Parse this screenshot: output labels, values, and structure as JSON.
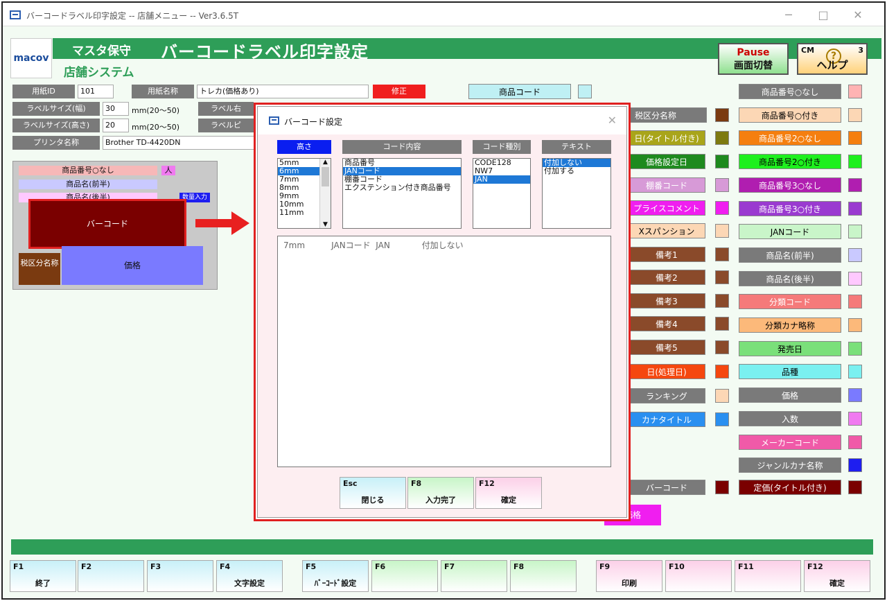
{
  "window": {
    "title": "バーコードラベル印字設定 -- 店舗メニュー -- Ver3.6.5T",
    "min": "─",
    "max": "□",
    "close": "✕"
  },
  "header": {
    "logo": "macov",
    "maint": "マスタ保守",
    "title": "バーコードラベル印字設定",
    "system": "店舗システム"
  },
  "top_buttons": {
    "pause": "Pause",
    "pause_sub": "画面切替",
    "cm": "CM",
    "cm_num": "3",
    "help": "ヘルプ",
    "help_icon": "?"
  },
  "form": {
    "paper_id_label": "用紙ID",
    "paper_id": "101",
    "paper_name_label": "用紙名称",
    "paper_name": "トレカ(価格あり)",
    "fix_label": "修正",
    "width_label": "ラベルサイズ(幅)",
    "width": "30",
    "width_unit": "mm(20～50)",
    "height_label": "ラベルサイズ(高さ)",
    "height": "20",
    "height_unit": "mm(20～50)",
    "margin_label": "ラベル右",
    "pitch_label": "ラベルピ",
    "printer_label": "プリンタ名称",
    "printer": "Brother TD-4420DN"
  },
  "preview": {
    "row1": "商品番号○なし",
    "row1_tag": "人",
    "row2": "商品名(前半)",
    "row3": "商品名(後半)",
    "row3_tag": "数量入力",
    "barcode": "バーコード",
    "tax": "税区分名称",
    "price": "価格"
  },
  "right_col1": [
    {
      "label": "商品コード",
      "bg": "#bff0f4",
      "fg": "#000",
      "swatch": "#bff0f4"
    },
    {
      "label": "税区分名称",
      "bg": "#7a7a7a",
      "fg": "#fff",
      "swatch": "#7a3a10"
    },
    {
      "label": "日(タイトル付き)",
      "bg": "#a9a51a",
      "fg": "#fff",
      "swatch": "#7d7a10"
    },
    {
      "label": "価格設定日",
      "bg": "#1e8a1e",
      "fg": "#fff",
      "swatch": "#1e8a1e"
    },
    {
      "label": "棚番コード",
      "bg": "#d79ad7",
      "fg": "#fff",
      "swatch": "#d79ad7"
    },
    {
      "label": "プライスコメント",
      "bg": "#f01ef0",
      "fg": "#fff",
      "swatch": "#f01ef0"
    },
    {
      "label": "Xスパンション",
      "bg": "#fcd7b5",
      "fg": "#000",
      "swatch": "#fcd7b5"
    },
    {
      "label": "備考1",
      "bg": "#8a4a2a",
      "fg": "#fff",
      "swatch": "#8a4a2a"
    },
    {
      "label": "備考2",
      "bg": "#8a4a2a",
      "fg": "#fff",
      "swatch": "#8a4a2a"
    },
    {
      "label": "備考3",
      "bg": "#8a4a2a",
      "fg": "#fff",
      "swatch": "#8a4a2a"
    },
    {
      "label": "備考4",
      "bg": "#8a4a2a",
      "fg": "#fff",
      "swatch": "#8a4a2a"
    },
    {
      "label": "備考5",
      "bg": "#8a4a2a",
      "fg": "#fff",
      "swatch": "#8a4a2a"
    },
    {
      "label": "日(処理日)",
      "bg": "#f5470f",
      "fg": "#fff",
      "swatch": "#f5470f"
    },
    {
      "label": "ランキング",
      "bg": "#7a7a7a",
      "fg": "#fff",
      "swatch": "#fcd7b5"
    },
    {
      "label": "カナタイトル",
      "bg": "#2a8ff0",
      "fg": "#fff",
      "swatch": "#2a8ff0"
    }
  ],
  "right_col2": [
    {
      "label": "商品番号○なし",
      "bg": "#7a7a7a",
      "fg": "#fff",
      "swatch": "#ffb3b3"
    },
    {
      "label": "商品番号○付き",
      "bg": "#fcd7b5",
      "fg": "#000",
      "swatch": "#fcd7b5"
    },
    {
      "label": "商品番号2○なし",
      "bg": "#f57f0f",
      "fg": "#fff",
      "swatch": "#f57f0f"
    },
    {
      "label": "商品番号2○付き",
      "bg": "#1ef01e",
      "fg": "#000",
      "swatch": "#1ef01e"
    },
    {
      "label": "商品番号3○なし",
      "bg": "#b01eb0",
      "fg": "#fff",
      "swatch": "#b01eb0"
    },
    {
      "label": "商品番号3○付き",
      "bg": "#9a3ad0",
      "fg": "#fff",
      "swatch": "#9a3ad0"
    },
    {
      "label": "JANコード",
      "bg": "#c9f5c9",
      "fg": "#000",
      "swatch": "#c9f5c9"
    },
    {
      "label": "商品名(前半)",
      "bg": "#7a7a7a",
      "fg": "#fff",
      "swatch": "#c9c9ff"
    },
    {
      "label": "商品名(後半)",
      "bg": "#7a7a7a",
      "fg": "#fff",
      "swatch": "#ffc9ff"
    },
    {
      "label": "分類コード",
      "bg": "#f57a7a",
      "fg": "#fff",
      "swatch": "#f57a7a"
    },
    {
      "label": "分類カナ略称",
      "bg": "#fcb97a",
      "fg": "#000",
      "swatch": "#fcb97a"
    },
    {
      "label": "発売日",
      "bg": "#7ae07a",
      "fg": "#000",
      "swatch": "#7ae07a"
    },
    {
      "label": "品種",
      "bg": "#7af0f0",
      "fg": "#000",
      "swatch": "#7af0f0"
    },
    {
      "label": "価格",
      "bg": "#7a7a7a",
      "fg": "#fff",
      "swatch": "#7a7aff"
    },
    {
      "label": "入数",
      "bg": "#7a7a7a",
      "fg": "#fff",
      "swatch": "#f07af0"
    },
    {
      "label": "メーカーコード",
      "bg": "#f05aa8",
      "fg": "#fff",
      "swatch": "#f05aa8"
    },
    {
      "label": "ジャンルカナ名称",
      "bg": "#7a7a7a",
      "fg": "#fff",
      "swatch": "#1e1ef0"
    }
  ],
  "bottom_right": {
    "barcode_label": "バーコード",
    "barcode_swatch": "#7a0000",
    "teika": "定価(タイトル付き)",
    "teika_swatch": "#7a0000",
    "magenta": "価格"
  },
  "dialog": {
    "title": "バーコード設定",
    "close": "✕",
    "hdr_height": "高さ",
    "hdr_content": "コード内容",
    "hdr_type": "コード種別",
    "hdr_text": "テキスト",
    "heights": [
      "5mm",
      "6mm",
      "7mm",
      "8mm",
      "9mm",
      "10mm",
      "11mm"
    ],
    "heights_sel": 1,
    "contents": [
      "商品番号",
      "JANコード",
      "棚番コード",
      "エクステンション付き商品番号"
    ],
    "contents_sel": 1,
    "types": [
      "CODE128",
      "NW7",
      "JAN"
    ],
    "types_sel": 2,
    "texts": [
      "付加しない",
      "付加する"
    ],
    "texts_sel": 0,
    "summary": "7mm          JANコード  JAN            付加しない",
    "btns": [
      {
        "key": "Esc",
        "label": "閉じる"
      },
      {
        "key": "F8",
        "label": "入力完了"
      },
      {
        "key": "F12",
        "label": "確定"
      }
    ]
  },
  "fkeys": [
    {
      "key": "F1",
      "label": "終了"
    },
    {
      "key": "F2",
      "label": ""
    },
    {
      "key": "F3",
      "label": ""
    },
    {
      "key": "F4",
      "label": "文字設定"
    },
    {
      "key": "F5",
      "label": "ﾊﾞｰｺｰﾄﾞ設定"
    },
    {
      "key": "F6",
      "label": ""
    },
    {
      "key": "F7",
      "label": ""
    },
    {
      "key": "F8",
      "label": ""
    },
    {
      "key": "F9",
      "label": "印刷"
    },
    {
      "key": "F10",
      "label": ""
    },
    {
      "key": "F11",
      "label": ""
    },
    {
      "key": "F12",
      "label": "確定"
    }
  ]
}
